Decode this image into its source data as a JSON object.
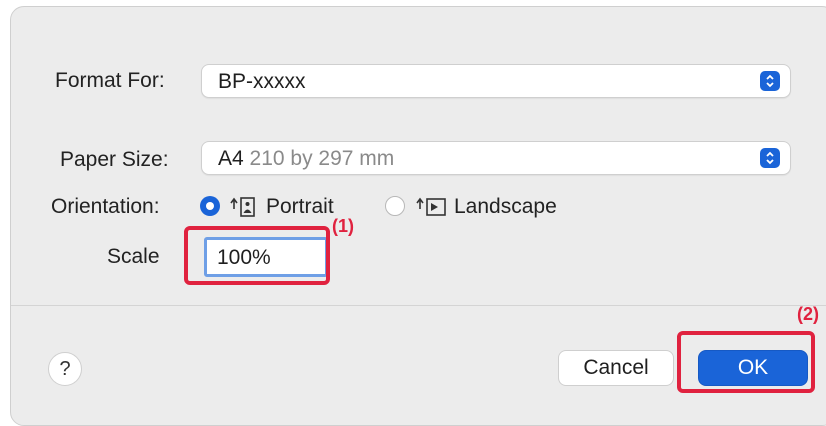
{
  "format_for": {
    "label": "Format For:",
    "value": "BP-xxxxx"
  },
  "paper_size": {
    "label": "Paper Size:",
    "value": "A4",
    "detail": "210 by 297 mm"
  },
  "orientation": {
    "label": "Orientation:",
    "options": [
      {
        "label": "Portrait",
        "selected": true
      },
      {
        "label": "Landscape",
        "selected": false
      }
    ]
  },
  "scale": {
    "label": "Scale",
    "value": "100%"
  },
  "callouts": {
    "scale": "(1)",
    "ok": "(2)"
  },
  "buttons": {
    "help": "?",
    "cancel": "Cancel",
    "ok": "OK"
  },
  "colors": {
    "accent": "#1a64d8",
    "callout": "#e0223f",
    "field_focus": "#6f9fe6"
  }
}
